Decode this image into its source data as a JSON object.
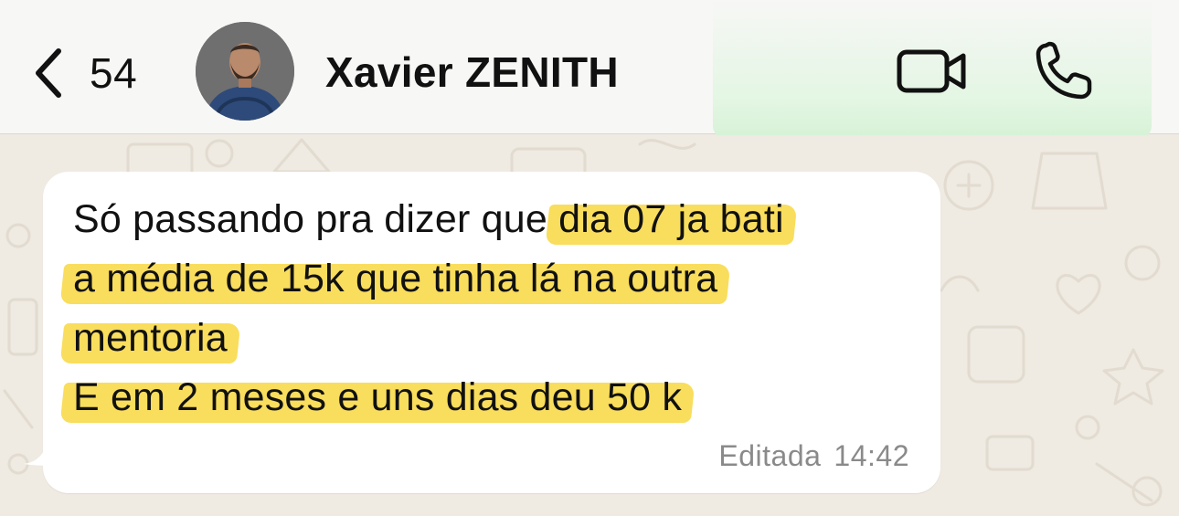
{
  "header": {
    "back_count": "54",
    "contact_name": "Xavier ZENITH",
    "icons": {
      "back": "chevron-left-icon",
      "video": "video-camera-icon",
      "call": "phone-icon"
    }
  },
  "message": {
    "lines": [
      {
        "plain": "Só passando pra dizer que ",
        "highlighted": "dia 07 ja bati"
      },
      {
        "plain": "",
        "highlighted": "a média de 15k que tinha lá na outra"
      },
      {
        "plain": "",
        "highlighted": "mentoria"
      },
      {
        "plain": "",
        "highlighted": "E em 2 meses e uns dias deu 50 k"
      }
    ],
    "edited_label": "Editada",
    "time": "14:42"
  },
  "colors": {
    "highlight": "#f8d845",
    "chat_background": "#efeae2",
    "bubble": "#ffffff",
    "header": "#f7f7f5"
  }
}
